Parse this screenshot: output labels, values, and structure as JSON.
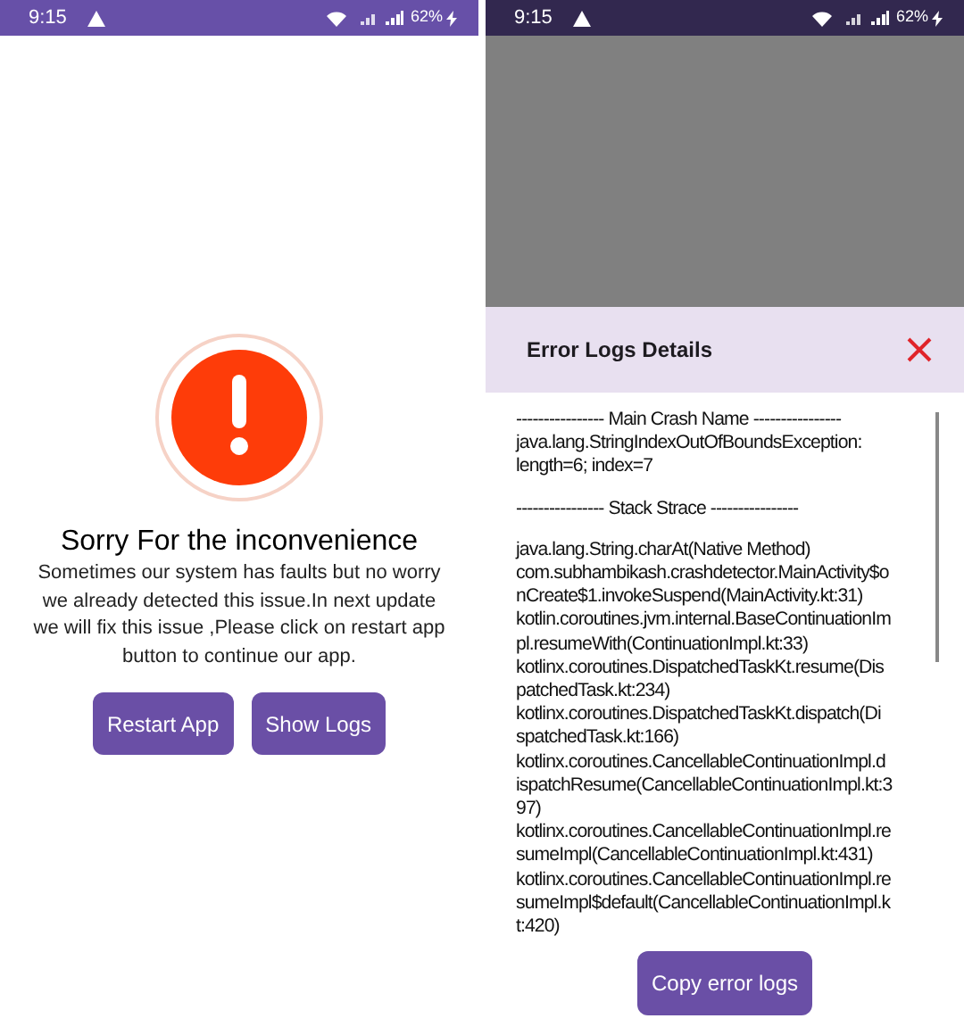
{
  "screens": [
    {
      "status_bar": {
        "time": "9:15",
        "battery": "62%",
        "dimmed": false
      },
      "title": "Sorry For the inconvenience",
      "message": "Sometimes our system has faults but no worry we already detected this issue.In next update we will fix this issue ,Please click on restart app button to continue our app.",
      "buttons": [
        "Restart App",
        "Show Logs"
      ]
    },
    {
      "status_bar": {
        "time": "9:15",
        "battery": "62%",
        "dimmed": true
      },
      "sheet": {
        "title": "Error Logs Details",
        "log_sections": [
          [
            "---------------- Main Crash Name ----------------",
            "java.lang.StringIndexOutOfBoundsException:",
            "length=6; index=7"
          ],
          [
            "---------------- Stack Strace ----------------"
          ],
          [
            "java.lang.String.charAt(Native Method)",
            "com.subhambikash.crashdetector.MainActivity$o",
            "nCreate$1.invokeSuspend(MainActivity.kt:31)",
            "kotlin.coroutines.jvm.internal.BaseContinuationIm",
            "pl.resumeWith(ContinuationImpl.kt:33)",
            "kotlinx.coroutines.DispatchedTaskKt.resume(Dis",
            "patchedTask.kt:234)",
            "kotlinx.coroutines.DispatchedTaskKt.dispatch(Di",
            "spatchedTask.kt:166)",
            "kotlinx.coroutines.CancellableContinuationImpl.d",
            "ispatchResume(CancellableContinuationImpl.kt:3",
            "97)",
            "kotlinx.coroutines.CancellableContinuationImpl.re",
            "sumeImpl(CancellableContinuationImpl.kt:431)",
            "kotlinx.coroutines.CancellableContinuationImpl.re",
            "sumeImpl$default(CancellableContinuationImpl.k",
            "t:420)"
          ]
        ],
        "button": "Copy error logs"
      }
    }
  ]
}
